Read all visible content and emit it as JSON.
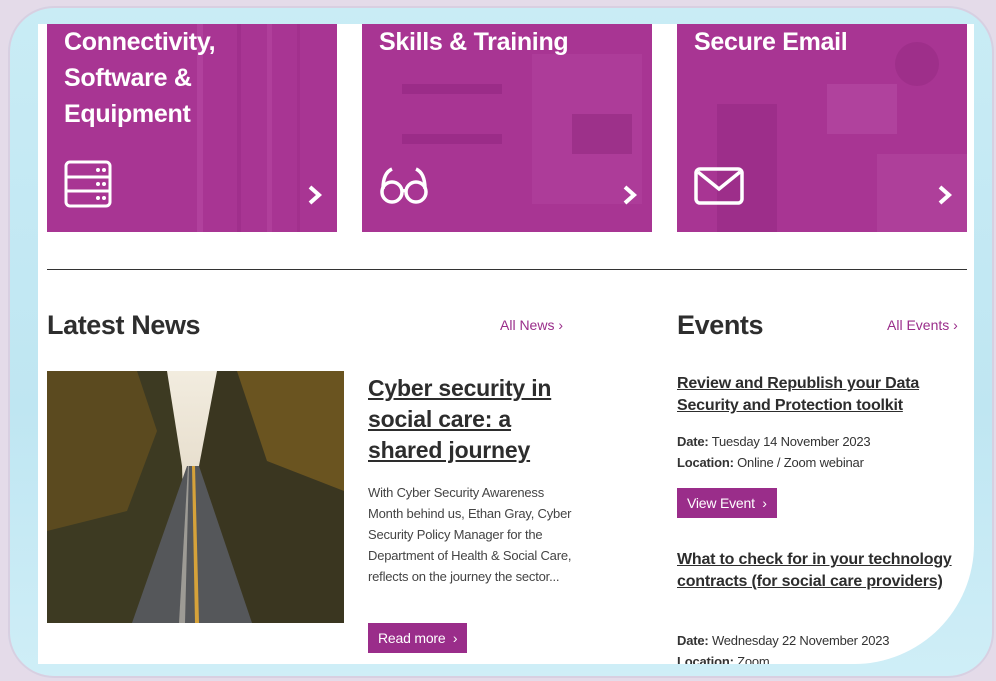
{
  "tiles": [
    {
      "title": "Connectivity,\nSoftware &\nEquipment",
      "icon": "server-icon"
    },
    {
      "title": "Skills & Training",
      "icon": "glasses-icon"
    },
    {
      "title": "Secure Email",
      "icon": "envelope-icon"
    }
  ],
  "news": {
    "heading": "Latest News",
    "all_link": "All News",
    "article": {
      "title": "Cyber security in social care: a shared journey",
      "excerpt": "With Cyber Security Awareness Month behind us, Ethan Gray, Cyber Security Policy Manager for the Department of Health & Social Care, reflects on the journey the sector...",
      "button": "Read more"
    }
  },
  "events": {
    "heading": "Events",
    "all_link": "All Events",
    "items": [
      {
        "title": "Review and Republish your Data Security and Protection toolkit",
        "date_label": "Date:",
        "date": "Tuesday 14 November 2023",
        "location_label": "Location:",
        "location": "Online / Zoom webinar",
        "button": "View Event"
      },
      {
        "title": "What to check for in your technology contracts (for social care providers)",
        "date_label": "Date:",
        "date": "Wednesday 22 November 2023",
        "location_label": "Location:",
        "location": "Zoom"
      }
    ]
  },
  "colors": {
    "brand": "#a93594",
    "link": "#9a2d8a"
  }
}
